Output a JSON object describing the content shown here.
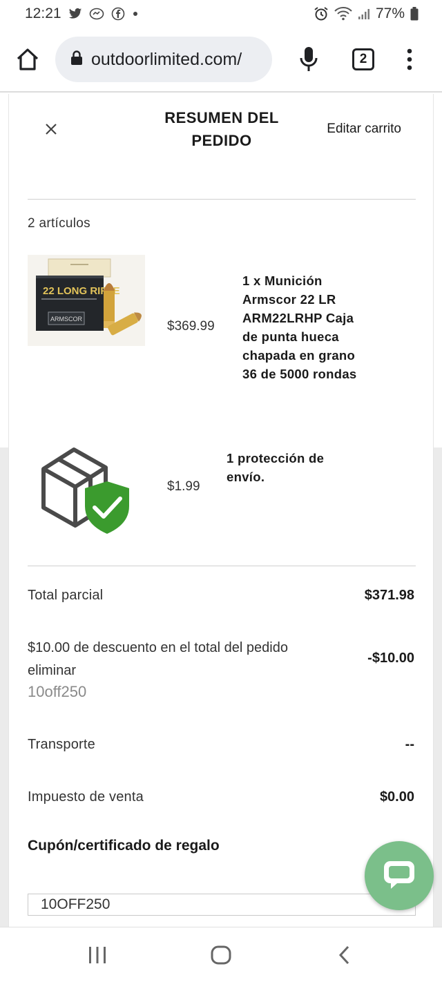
{
  "status_bar": {
    "time": "12:21",
    "battery": "77%",
    "icons": [
      "twitter-icon",
      "messenger-icon",
      "facebook-icon",
      "dot-icon",
      "alarm-icon",
      "wifi-icon",
      "signal-icon",
      "battery-icon"
    ]
  },
  "browser": {
    "url": "outdoorlimited.com/",
    "tab_count": "2",
    "icons": [
      "home-icon",
      "lock-icon",
      "mic-icon",
      "tabs-icon",
      "more-vert-icon"
    ]
  },
  "drawer": {
    "title_line1": "RESUMEN DEL",
    "title_line2": "PEDIDO",
    "edit_cart": "Editar carrito",
    "items_count": "2 artículos",
    "items": [
      {
        "price": "$369.99",
        "name": [
          "1 x Munición",
          "Armscor 22 LR",
          "ARM22LRHP Caja",
          "de punta hueca",
          "chapada en grano",
          "36 de 5000 rondas"
        ],
        "image_label": "22 LONG RIFLE",
        "image_brand": "ARMSCOR"
      },
      {
        "price": "$1.99",
        "name": [
          "1 protección de",
          "envío."
        ]
      }
    ],
    "summary": {
      "subtotal_label": "Total parcial",
      "subtotal_value": "$371.98",
      "discount_text": "$10.00 de descuento en el total del pedido",
      "discount_remove": "eliminar",
      "discount_code": "10off250",
      "discount_value": "-$10.00",
      "shipping_label": "Transporte",
      "shipping_value": "--",
      "tax_label": "Impuesto de venta",
      "tax_value": "$0.00"
    },
    "coupon": {
      "title": "Cupón/certificado de regalo",
      "value": "10OFF250"
    }
  },
  "colors": {
    "accent_green": "#3b9b2e",
    "chat_green": "#7bbf8a",
    "ammo_gold": "#d2a33b"
  }
}
